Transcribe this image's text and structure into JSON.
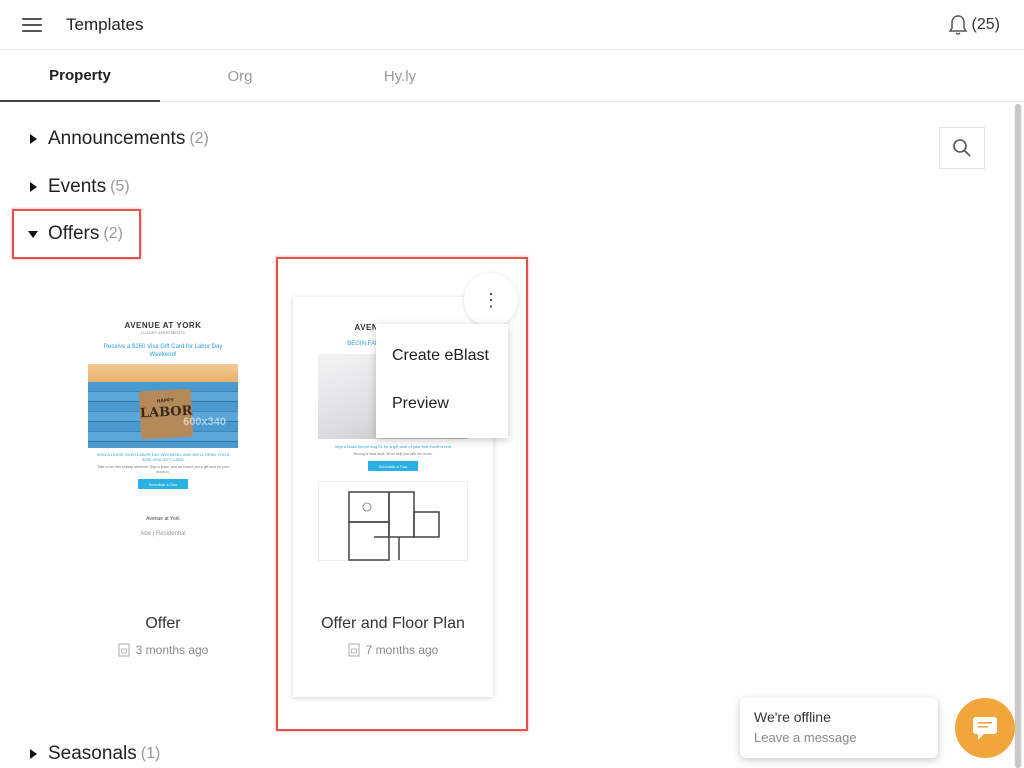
{
  "header": {
    "title": "Templates",
    "notification_count": "(25)"
  },
  "tabs": [
    {
      "label": "Property",
      "active": true
    },
    {
      "label": "Org",
      "active": false
    },
    {
      "label": "Hy.ly",
      "active": false
    }
  ],
  "categories": [
    {
      "label": "Announcements",
      "count": "(2)",
      "expanded": false
    },
    {
      "label": "Events",
      "count": "(5)",
      "expanded": false
    },
    {
      "label": "Offers",
      "count": "(2)",
      "expanded": true
    },
    {
      "label": "Seasonals",
      "count": "(1)",
      "expanded": false
    }
  ],
  "templates": [
    {
      "name": "Offer",
      "age": "3 months ago",
      "preview": {
        "logo": "AVENUE AT YORK",
        "logo_sub": "LUXURY APARTMENTS",
        "headline": "Receive a $250 Visa Gift Card for Labor Day Weekend!",
        "image_happy": "HAPPY",
        "image_labor": "LABOR",
        "image_size": "600x340",
        "subhead": "SIGN A LEASE OVER LABOR DAY WEEKEND, AND WE'LL SEND YOU A $250 VISA GIFT CARD",
        "body": "Take a tour this holiday weekend. Sign a lease, and we'll send you a gift card for your move-in.",
        "button": "Schedule a Tour",
        "footer_name": "Avenue at York",
        "footer_brand": "Abe | Residential"
      }
    },
    {
      "name": "Offer and Floor Plan",
      "age": "7 months ago",
      "preview": {
        "logo": "AVENUE AT YORK",
        "headline": "BEGIN FALL WITH A NEW HOME",
        "subhead": "Sign a lease before Aug 31 for a gift card of your first month's rent",
        "body": "Moving is hard work; let us help you with the move.",
        "button": "Schedule a Tour"
      }
    }
  ],
  "context_menu": {
    "items": [
      "Create eBlast",
      "Preview"
    ],
    "trigger": "⋮"
  },
  "chat": {
    "title": "We're offline",
    "subtitle": "Leave a message"
  },
  "colors": {
    "highlight": "#e0554b",
    "chat_button": "#f0a63b",
    "accent_blue": "#2aa3dd"
  }
}
